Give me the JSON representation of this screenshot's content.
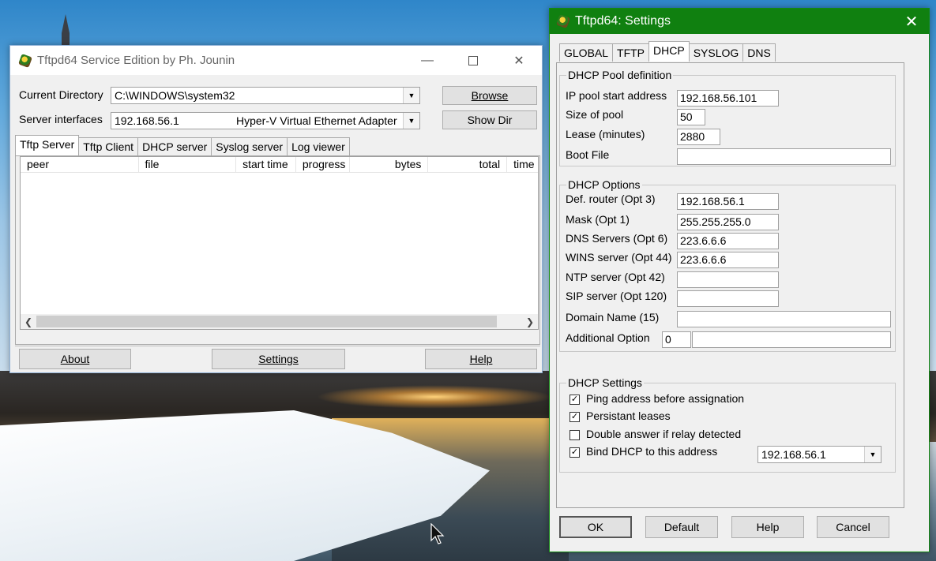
{
  "main_window": {
    "title": "Tftpd64 Service Edition by Ph. Jounin",
    "current_directory_label": "Current Directory",
    "current_directory_value": "C:\\WINDOWS\\system32",
    "server_interfaces_label": "Server interfaces",
    "server_interface_ip": "192.168.56.1",
    "server_interface_name": "Hyper-V Virtual Ethernet Adapter",
    "browse_label": "Browse",
    "showdir_label": "Show Dir",
    "tabs": [
      {
        "label": "Tftp Server",
        "active": true
      },
      {
        "label": "Tftp Client"
      },
      {
        "label": "DHCP server"
      },
      {
        "label": "Syslog server"
      },
      {
        "label": "Log viewer"
      }
    ],
    "columns": [
      "peer",
      "file",
      "start time",
      "progress",
      "bytes",
      "total",
      "time"
    ],
    "about_label": "About",
    "settings_label": "Settings",
    "help_label": "Help"
  },
  "settings_window": {
    "title": "Tftpd64: Settings",
    "tabs": [
      {
        "label": "GLOBAL"
      },
      {
        "label": "TFTP"
      },
      {
        "label": "DHCP",
        "active": true
      },
      {
        "label": "SYSLOG"
      },
      {
        "label": "DNS"
      }
    ],
    "pool_group": "DHCP Pool definition",
    "pool": {
      "start_label": "IP pool start address",
      "start_value": "192.168.56.101",
      "size_label": "Size of pool",
      "size_value": "50",
      "lease_label": "Lease (minutes)",
      "lease_value": "2880",
      "boot_label": "Boot File",
      "boot_value": ""
    },
    "options_group": "DHCP Options",
    "options": {
      "router_label": "Def. router (Opt 3)",
      "router_value": "192.168.56.1",
      "mask_label": "Mask (Opt 1)",
      "mask_value": "255.255.255.0",
      "dns_label": "DNS Servers (Opt 6)",
      "dns_value": "223.6.6.6",
      "wins_label": "WINS server (Opt 44)",
      "wins_value": "223.6.6.6",
      "ntp_label": "NTP server (Opt 42)",
      "ntp_value": "",
      "sip_label": "SIP server (Opt 120)",
      "sip_value": "",
      "domain_label": "Domain Name (15)",
      "domain_value": "",
      "additional_label": "Additional Option",
      "additional_num": "0",
      "additional_value": ""
    },
    "settings_group": "DHCP Settings",
    "checks": {
      "ping_label": "Ping address before assignation",
      "ping_checked": true,
      "persist_label": "Persistant leases",
      "persist_checked": true,
      "double_label": "Double answer if relay detected",
      "double_checked": false,
      "bind_label": "Bind DHCP to this address",
      "bind_checked": true,
      "bind_value": "192.168.56.1"
    },
    "ok_label": "OK",
    "default_label": "Default",
    "help_label": "Help",
    "cancel_label": "Cancel"
  }
}
